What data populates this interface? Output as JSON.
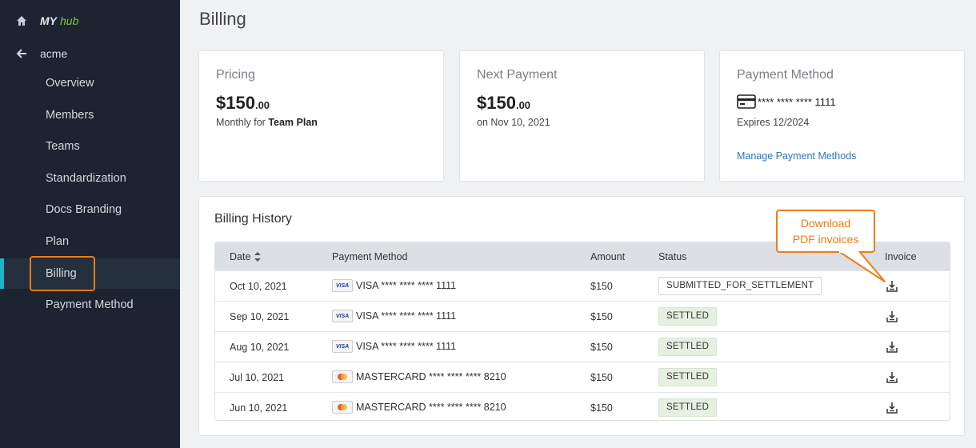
{
  "sidebar": {
    "brand_my": "MY",
    "brand_hub": "hub",
    "org": "acme",
    "items": [
      {
        "label": "Overview"
      },
      {
        "label": "Members"
      },
      {
        "label": "Teams"
      },
      {
        "label": "Standardization"
      },
      {
        "label": "Docs Branding"
      },
      {
        "label": "Plan"
      },
      {
        "label": "Billing",
        "active": true
      },
      {
        "label": "Payment Method"
      }
    ]
  },
  "page": {
    "title": "Billing"
  },
  "pricing": {
    "title": "Pricing",
    "amount": "$150",
    "cents": ".00",
    "sub_prefix": "Monthly for ",
    "plan": "Team Plan"
  },
  "next_payment": {
    "title": "Next Payment",
    "amount": "$150",
    "cents": ".00",
    "date": "on Nov 10, 2021"
  },
  "payment_method": {
    "title": "Payment Method",
    "card": "**** **** **** 1111",
    "expires": "Expires 12/2024",
    "manage_link": "Manage Payment Methods"
  },
  "history": {
    "title": "Billing History",
    "columns": {
      "date": "Date",
      "method": "Payment Method",
      "amount": "Amount",
      "status": "Status",
      "invoice": "Invoice"
    },
    "rows": [
      {
        "date": "Oct 10, 2021",
        "brand": "visa",
        "method": "VISA **** **** **** 1111",
        "amount": "$150",
        "status": "SUBMITTED_FOR_SETTLEMENT"
      },
      {
        "date": "Sep 10, 2021",
        "brand": "visa",
        "method": "VISA **** **** **** 1111",
        "amount": "$150",
        "status": "SETTLED"
      },
      {
        "date": "Aug 10, 2021",
        "brand": "visa",
        "method": "VISA **** **** **** 1111",
        "amount": "$150",
        "status": "SETTLED"
      },
      {
        "date": "Jul 10, 2021",
        "brand": "mastercard",
        "method": "MASTERCARD **** **** **** 8210",
        "amount": "$150",
        "status": "SETTLED"
      },
      {
        "date": "Jun 10, 2021",
        "brand": "mastercard",
        "method": "MASTERCARD **** **** **** 8210",
        "amount": "$150",
        "status": "SETTLED"
      }
    ]
  },
  "callout": {
    "line1": "Download",
    "line2": "PDF invoices"
  },
  "card_brand_text": {
    "visa": "VISA"
  },
  "colors": {
    "sidebar_bg": "#1b2430",
    "active_accent": "#1fb5c4",
    "highlight": "#f07c14",
    "link": "#2f76b5",
    "settled_bg": "#e6f0e0"
  },
  "icons": {
    "home": "home-icon",
    "back": "arrow-left-icon",
    "credit_card": "credit-card-icon",
    "sort": "sort-icon",
    "download": "download-icon"
  }
}
